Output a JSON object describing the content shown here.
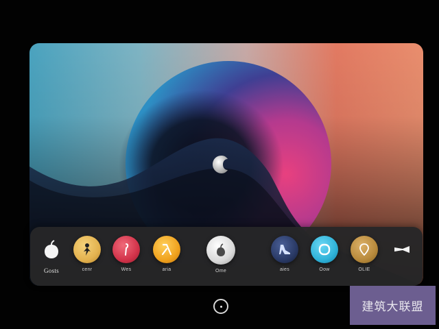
{
  "wallpaper": {
    "logo": "apple-logo-icon",
    "colors": {
      "teal": "#4aa3bf",
      "coral": "#e27a62",
      "magenta": "#d93d86",
      "navy": "#13233f"
    }
  },
  "dock": {
    "apps": [
      {
        "label": "Gosts",
        "icon": "apple-icon",
        "color": "#ffffff"
      },
      {
        "label": "cenr",
        "icon": "figure-icon",
        "color": "#e3b24f"
      },
      {
        "label": "Wes",
        "icon": "pin-icon",
        "color": "#d2334a"
      },
      {
        "label": "aria",
        "icon": "lambda-icon",
        "color": "#f0a21e"
      },
      {
        "label": "Ome",
        "icon": "apple-icon",
        "color": "#e8e8e8"
      },
      {
        "label": "aies",
        "icon": "heel-icon",
        "color": "#2a3a66"
      },
      {
        "label": "Oow",
        "icon": "ring-icon",
        "color": "#2fb2d8"
      },
      {
        "label": "OLIE",
        "icon": "location-icon",
        "color": "#b88a3c"
      },
      {
        "label": "",
        "icon": "trumpet-icon",
        "color": "#ffffff"
      }
    ]
  },
  "home_button": {
    "icon": "home-button-icon"
  },
  "watermark": {
    "text": "建筑大联盟"
  }
}
